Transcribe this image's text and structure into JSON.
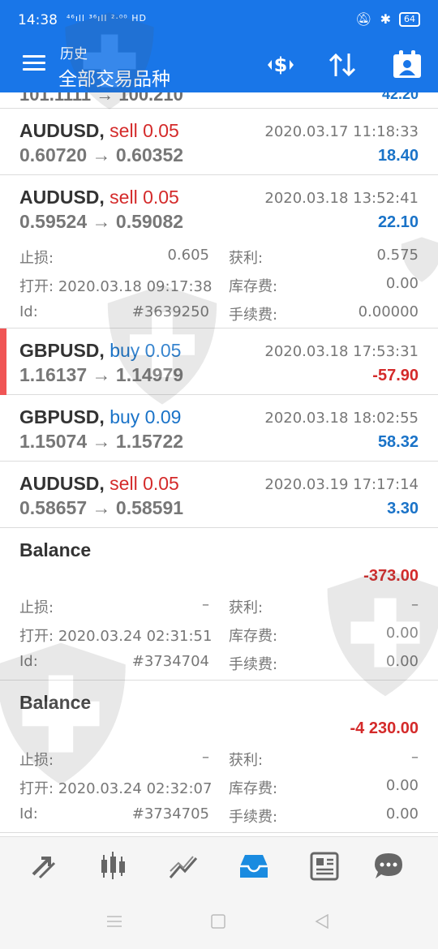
{
  "status": {
    "time": "14:38",
    "signal": "⁴⁶ıll ³⁶ıll ²·⁰⁰ HD",
    "battery": "64"
  },
  "app": {
    "title": "历史",
    "subtitle": "全部交易品种",
    "accent": "#1976e8"
  },
  "partial_row": {
    "text": "101.1111 → 100.210",
    "profit": "42.20"
  },
  "trades": [
    {
      "symbol": "AUDUSD,",
      "side": "sell",
      "volume": "0.05",
      "prices": "0.60720 → 0.60352",
      "datetime": "2020.03.17 11:18:33",
      "profit": "18.40"
    },
    {
      "symbol": "AUDUSD,",
      "side": "sell",
      "volume": "0.05",
      "prices": "0.59524 → 0.59082",
      "datetime": "2020.03.18 13:52:41",
      "profit": "22.10",
      "details": {
        "sl_label": "止损:",
        "sl": "0.605",
        "tp_label": "获利:",
        "tp": "0.575",
        "open_label": "打开:",
        "open": "2020.03.18 09:17:38",
        "swap_label": "库存费:",
        "swap": "0.00",
        "id_label": "Id:",
        "id": "#3639250",
        "fee_label": "手续费:",
        "fee": "0.00000"
      }
    },
    {
      "symbol": "GBPUSD,",
      "side": "buy",
      "volume": "0.05",
      "prices": "1.16137 → 1.14979",
      "datetime": "2020.03.18 17:53:31",
      "profit": "-57.90"
    },
    {
      "symbol": "GBPUSD,",
      "side": "buy",
      "volume": "0.09",
      "prices": "1.15074 → 1.15722",
      "datetime": "2020.03.18 18:02:55",
      "profit": "58.32"
    },
    {
      "symbol": "AUDUSD,",
      "side": "sell",
      "volume": "0.05",
      "prices": "0.58657 → 0.58591",
      "datetime": "2020.03.19 17:17:14",
      "profit": "3.30"
    }
  ],
  "balances": [
    {
      "title": "Balance",
      "amount": "-373.00",
      "sl_label": "止损:",
      "sl": "–",
      "tp_label": "获利:",
      "tp": "–",
      "open_label": "打开:",
      "open": "2020.03.24 02:31:51",
      "swap_label": "库存费:",
      "swap": "0.00",
      "id_label": "Id:",
      "id": "#3734704",
      "fee_label": "手续费:",
      "fee": "0.00"
    },
    {
      "title": "Balance",
      "amount": "-4 230.00",
      "sl_label": "止损:",
      "sl": "–",
      "tp_label": "获利:",
      "tp": "–",
      "open_label": "打开:",
      "open": "2020.03.24 02:32:07",
      "swap_label": "库存费:",
      "swap": "0.00",
      "id_label": "Id:",
      "id": "#3734705",
      "fee_label": "手续费:",
      "fee": "0.00"
    }
  ],
  "colors": {
    "positive": "#1a73c8",
    "negative": "#d42a2a",
    "marker": "#f05555"
  },
  "tabs": [
    "trade-icon",
    "quotes-icon",
    "chart-icon",
    "history-icon",
    "news-icon",
    "chat-icon"
  ]
}
